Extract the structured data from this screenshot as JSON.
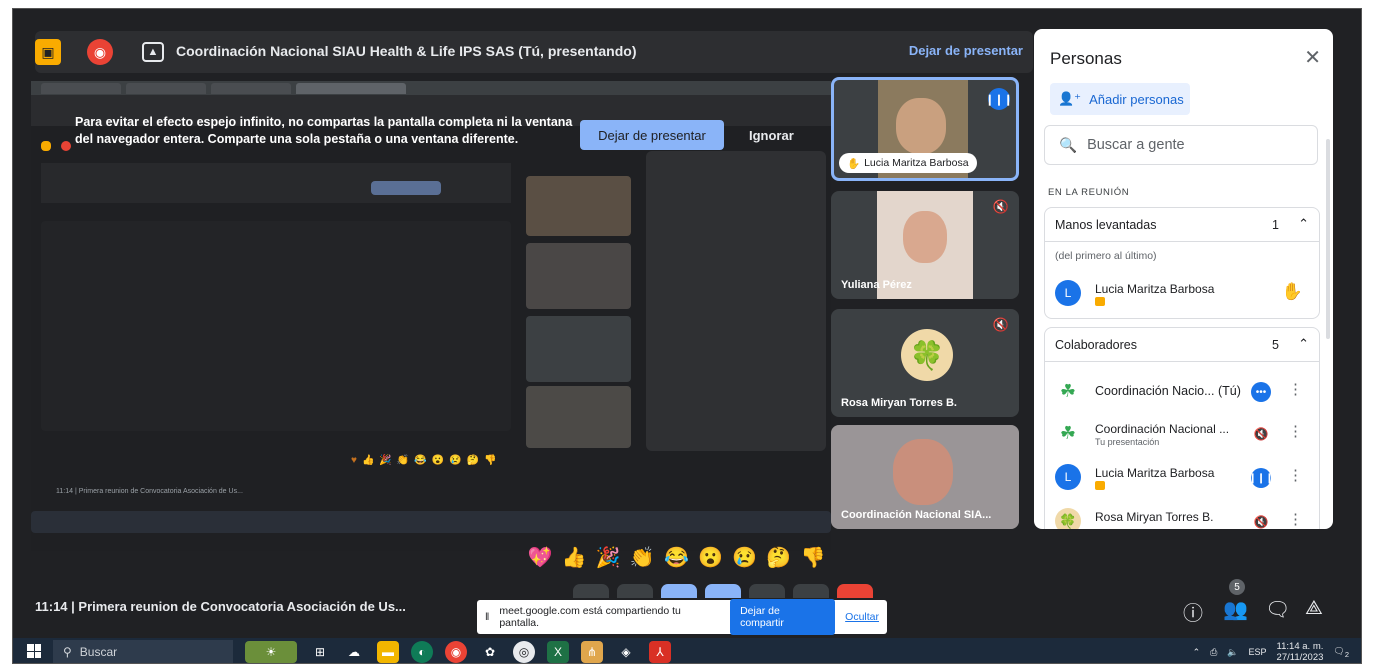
{
  "presenting_bar": {
    "title": "Coordinación Nacional SIAU Health & Life IPS SAS (Tú, presentando)",
    "stop_label": "Dejar de presentar"
  },
  "warning": {
    "text": "Para evitar el efecto espejo infinito, no compartas la pantalla completa ni la ventana del navegador entera. Comparte una sola pestaña o una ventana diferente.",
    "stop_button": "Dejar de presentar",
    "ignore_button": "Ignorar"
  },
  "tiles": [
    {
      "name": "Lucia Maritza Barbosa",
      "state": "speaking"
    },
    {
      "name": "Yuliana Pérez",
      "state": "muted"
    },
    {
      "name": "Rosa Miryan Torres B.",
      "state": "muted"
    },
    {
      "name": "Coordinación Nacional SIA...",
      "state": "none"
    }
  ],
  "people_panel": {
    "title": "Personas",
    "add_label": "Añadir personas",
    "search_placeholder": "Buscar a gente",
    "section_label": "EN LA REUNIÓN",
    "raised_hands": {
      "title": "Manos levantadas",
      "count": "1",
      "hint": "(del primero al último)",
      "people": [
        {
          "name": "Lucia Maritza Barbosa",
          "initial": "L"
        }
      ]
    },
    "contributors": {
      "title": "Colaboradores",
      "count": "5",
      "people": [
        {
          "name": "Coordinación Nacio... (Tú)",
          "sub": ""
        },
        {
          "name": "Coordinación Nacional ...",
          "sub": "Tu presentación"
        },
        {
          "name": "Lucia Maritza Barbosa",
          "initial": "L",
          "sub": ""
        },
        {
          "name": "Rosa Miryan Torres B.",
          "sub": ""
        }
      ]
    }
  },
  "reactions": [
    "💖",
    "👍",
    "🎉",
    "👏",
    "😂",
    "😮",
    "😢",
    "🤔",
    "👎"
  ],
  "meeting": {
    "time_title": "11:14  |  Primera reunion de Convocatoria Asociación de Us...",
    "people_badge": "5"
  },
  "share_notice": {
    "text": "meet.google.com está compartiendo tu pantalla.",
    "stop_label": "Dejar de compartir",
    "hide_label": "Ocultar"
  },
  "taskbar": {
    "search_label": "Buscar",
    "lang": "ESP",
    "time": "11:14 a. m.",
    "date": "27/11/2023",
    "notif_count": "2"
  },
  "colors": {
    "meet_dark": "#202124",
    "accent_blue": "#8ab4f8",
    "google_blue": "#1a73e8",
    "stop_yellow": "#f9ab00",
    "record_red": "#ea4335"
  }
}
